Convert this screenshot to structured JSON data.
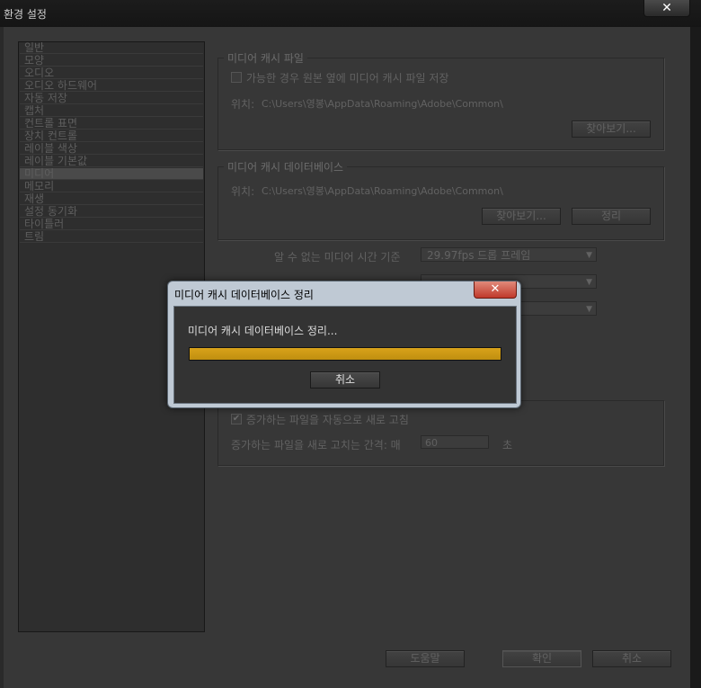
{
  "window": {
    "title": "환경 설정",
    "close_label": "✕"
  },
  "sidebar": {
    "items": [
      {
        "label": "일반"
      },
      {
        "label": "모양"
      },
      {
        "label": "오디오"
      },
      {
        "label": "오디오 하드웨어"
      },
      {
        "label": "자동 저장"
      },
      {
        "label": "캡처"
      },
      {
        "label": "컨트롤 표면"
      },
      {
        "label": "장치 컨트롤"
      },
      {
        "label": "레이블 색상"
      },
      {
        "label": "레이블 기본값"
      },
      {
        "label": "미디어",
        "selected": true
      },
      {
        "label": "메모리"
      },
      {
        "label": "재생"
      },
      {
        "label": "설정 동기화"
      },
      {
        "label": "타이틀러"
      },
      {
        "label": "트림"
      }
    ]
  },
  "media_cache_files": {
    "legend": "미디어 캐시 파일",
    "checkbox_label": "가능한 경우 원본 옆에 미디어 캐시 파일 저장",
    "location_label": "위치:",
    "location_path": "C:\\Users\\영봉\\AppData\\Roaming\\Adobe\\Common\\",
    "browse_label": "찾아보기..."
  },
  "media_cache_db": {
    "legend": "미디어 캐시 데이터베이스",
    "location_label": "위치:",
    "location_path": "C:\\Users\\영봉\\AppData\\Roaming\\Adobe\\Common\\",
    "browse_label": "찾아보기...",
    "clean_label": "정리"
  },
  "timebase": {
    "label": "알 수 없는 미디어 시간 기준",
    "value": "29.97fps 드롭 프레임"
  },
  "growing_files": {
    "auto_refresh_label": "증가하는 파일을 자동으로 새로 고침",
    "interval_label": "증가하는 파일을 새로 고치는 간격: 매",
    "interval_value": "60",
    "interval_unit": "초"
  },
  "footer": {
    "help_label": "도움말",
    "ok_label": "확인",
    "cancel_label": "취소"
  },
  "modal": {
    "title": "미디어 캐시 데이터베이스 정리",
    "close_label": "✕",
    "message": "미디어 캐시 데이터베이스 정리...",
    "progress": 1.0,
    "cancel_label": "취소",
    "progress_color": "#c08f10"
  }
}
